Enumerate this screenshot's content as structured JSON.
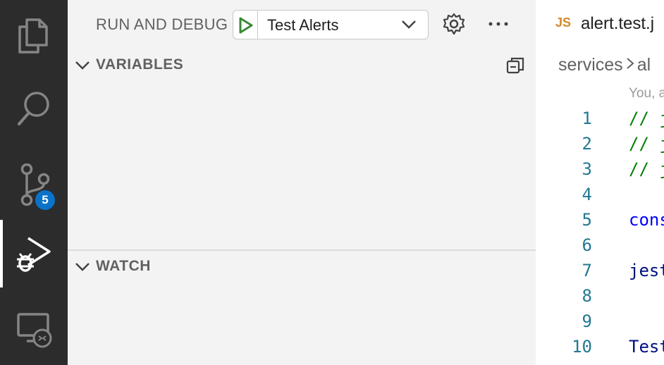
{
  "activity_bar": {
    "items": [
      {
        "name": "explorer",
        "icon": "files-icon"
      },
      {
        "name": "search",
        "icon": "search-icon"
      },
      {
        "name": "source-control",
        "icon": "source-control-icon",
        "badge": "5"
      },
      {
        "name": "run-and-debug",
        "icon": "run-debug-icon",
        "active": true
      },
      {
        "name": "remote-explorer",
        "icon": "remote-explorer-icon"
      }
    ]
  },
  "sidebar": {
    "title": "RUN AND DEBUG",
    "config_selected": "Test Alerts",
    "sections": {
      "variables": "VARIABLES",
      "watch": "WATCH"
    }
  },
  "editor": {
    "tab_icon": "JS",
    "tab_name": "alert.test.j",
    "breadcrumb": [
      "services",
      "al"
    ],
    "blame": "You, a",
    "lines": [
      {
        "n": "1",
        "text": "// j",
        "kind": "comment"
      },
      {
        "n": "2",
        "text": "// j",
        "kind": "comment"
      },
      {
        "n": "3",
        "text": "// j",
        "kind": "comment"
      },
      {
        "n": "4",
        "text": "",
        "kind": "plain"
      },
      {
        "n": "5",
        "text": "cons",
        "kind": "keyword"
      },
      {
        "n": "6",
        "text": "",
        "kind": "plain"
      },
      {
        "n": "7",
        "text": "jest",
        "kind": "ident"
      },
      {
        "n": "8",
        "text": "",
        "kind": "plain"
      },
      {
        "n": "9",
        "text": "",
        "kind": "plain"
      },
      {
        "n": "10",
        "text": "Test",
        "kind": "type"
      }
    ]
  },
  "colors": {
    "activity_bg": "#2c2c2c",
    "sidebar_bg": "#f3f3f3",
    "badge": "#0a72c9",
    "play_green": "#388a34",
    "line_number": "#237893",
    "comment": "#008000",
    "keyword": "#0000ff"
  }
}
